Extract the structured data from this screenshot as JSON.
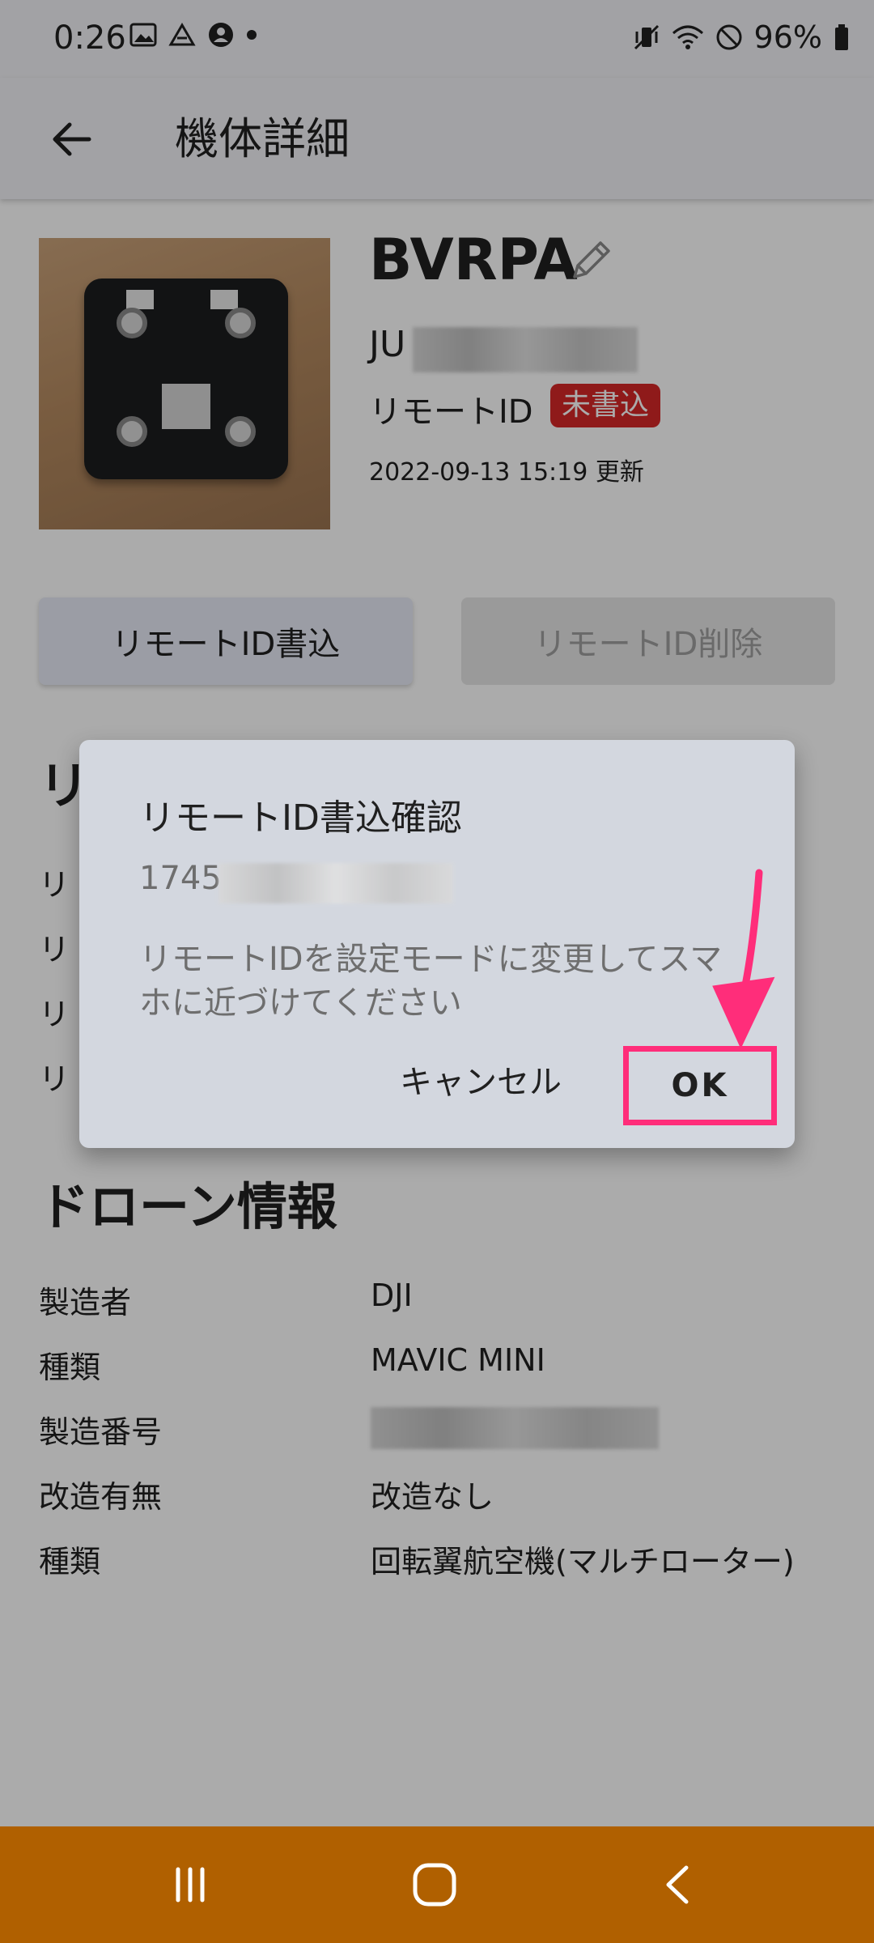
{
  "status_bar": {
    "time": "0:26",
    "battery": "96%",
    "left_icons": [
      "gallery-icon",
      "drive-icon",
      "account-icon",
      "dot-icon"
    ],
    "right_icons": [
      "vibrate-icon",
      "wifi-icon",
      "dnd-icon",
      "battery-icon"
    ]
  },
  "app_bar": {
    "title": "機体詳細"
  },
  "aircraft": {
    "name": "BVRPA",
    "registration_prefix": "JU",
    "remote_id_label": "リモートID",
    "remote_id_status": "未書込",
    "updated": "2022-09-13 15:19 更新"
  },
  "buttons": {
    "write": "リモートID書込",
    "delete": "リモートID削除"
  },
  "remote_id_section": {
    "title_partial": "リ",
    "row_labels": [
      "リ",
      "リ",
      "リ",
      "リ"
    ]
  },
  "drone_info": {
    "title": "ドローン情報",
    "rows": [
      {
        "label": "製造者",
        "value": "DJI"
      },
      {
        "label": "種類",
        "value": "MAVIC MINI"
      },
      {
        "label": "製造番号",
        "value": ""
      },
      {
        "label": "改造有無",
        "value": "改造なし"
      },
      {
        "label": "種類",
        "value": "回転翼航空機(マルチローター)"
      }
    ]
  },
  "dialog": {
    "title": "リモートID書込確認",
    "code_prefix": "1745",
    "message": "リモートIDを設定モードに変更してスマホに近づけてください",
    "cancel": "キャンセル",
    "ok": "OK"
  },
  "colors": {
    "badge": "#d62828",
    "highlight": "#ff2d7a",
    "nav_bar": "#b06000"
  }
}
